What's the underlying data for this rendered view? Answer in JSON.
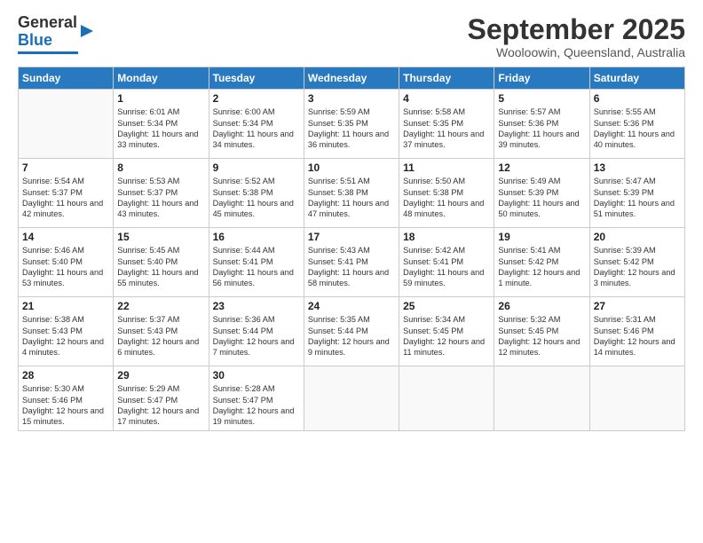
{
  "header": {
    "logo_line1": "General",
    "logo_line2": "Blue",
    "month": "September 2025",
    "location": "Wooloowin, Queensland, Australia"
  },
  "days_of_week": [
    "Sunday",
    "Monday",
    "Tuesday",
    "Wednesday",
    "Thursday",
    "Friday",
    "Saturday"
  ],
  "weeks": [
    [
      {
        "day": "",
        "sunrise": "",
        "sunset": "",
        "daylight": ""
      },
      {
        "day": "1",
        "sunrise": "Sunrise: 6:01 AM",
        "sunset": "Sunset: 5:34 PM",
        "daylight": "Daylight: 11 hours and 33 minutes."
      },
      {
        "day": "2",
        "sunrise": "Sunrise: 6:00 AM",
        "sunset": "Sunset: 5:34 PM",
        "daylight": "Daylight: 11 hours and 34 minutes."
      },
      {
        "day": "3",
        "sunrise": "Sunrise: 5:59 AM",
        "sunset": "Sunset: 5:35 PM",
        "daylight": "Daylight: 11 hours and 36 minutes."
      },
      {
        "day": "4",
        "sunrise": "Sunrise: 5:58 AM",
        "sunset": "Sunset: 5:35 PM",
        "daylight": "Daylight: 11 hours and 37 minutes."
      },
      {
        "day": "5",
        "sunrise": "Sunrise: 5:57 AM",
        "sunset": "Sunset: 5:36 PM",
        "daylight": "Daylight: 11 hours and 39 minutes."
      },
      {
        "day": "6",
        "sunrise": "Sunrise: 5:55 AM",
        "sunset": "Sunset: 5:36 PM",
        "daylight": "Daylight: 11 hours and 40 minutes."
      }
    ],
    [
      {
        "day": "7",
        "sunrise": "Sunrise: 5:54 AM",
        "sunset": "Sunset: 5:37 PM",
        "daylight": "Daylight: 11 hours and 42 minutes."
      },
      {
        "day": "8",
        "sunrise": "Sunrise: 5:53 AM",
        "sunset": "Sunset: 5:37 PM",
        "daylight": "Daylight: 11 hours and 43 minutes."
      },
      {
        "day": "9",
        "sunrise": "Sunrise: 5:52 AM",
        "sunset": "Sunset: 5:38 PM",
        "daylight": "Daylight: 11 hours and 45 minutes."
      },
      {
        "day": "10",
        "sunrise": "Sunrise: 5:51 AM",
        "sunset": "Sunset: 5:38 PM",
        "daylight": "Daylight: 11 hours and 47 minutes."
      },
      {
        "day": "11",
        "sunrise": "Sunrise: 5:50 AM",
        "sunset": "Sunset: 5:38 PM",
        "daylight": "Daylight: 11 hours and 48 minutes."
      },
      {
        "day": "12",
        "sunrise": "Sunrise: 5:49 AM",
        "sunset": "Sunset: 5:39 PM",
        "daylight": "Daylight: 11 hours and 50 minutes."
      },
      {
        "day": "13",
        "sunrise": "Sunrise: 5:47 AM",
        "sunset": "Sunset: 5:39 PM",
        "daylight": "Daylight: 11 hours and 51 minutes."
      }
    ],
    [
      {
        "day": "14",
        "sunrise": "Sunrise: 5:46 AM",
        "sunset": "Sunset: 5:40 PM",
        "daylight": "Daylight: 11 hours and 53 minutes."
      },
      {
        "day": "15",
        "sunrise": "Sunrise: 5:45 AM",
        "sunset": "Sunset: 5:40 PM",
        "daylight": "Daylight: 11 hours and 55 minutes."
      },
      {
        "day": "16",
        "sunrise": "Sunrise: 5:44 AM",
        "sunset": "Sunset: 5:41 PM",
        "daylight": "Daylight: 11 hours and 56 minutes."
      },
      {
        "day": "17",
        "sunrise": "Sunrise: 5:43 AM",
        "sunset": "Sunset: 5:41 PM",
        "daylight": "Daylight: 11 hours and 58 minutes."
      },
      {
        "day": "18",
        "sunrise": "Sunrise: 5:42 AM",
        "sunset": "Sunset: 5:41 PM",
        "daylight": "Daylight: 11 hours and 59 minutes."
      },
      {
        "day": "19",
        "sunrise": "Sunrise: 5:41 AM",
        "sunset": "Sunset: 5:42 PM",
        "daylight": "Daylight: 12 hours and 1 minute."
      },
      {
        "day": "20",
        "sunrise": "Sunrise: 5:39 AM",
        "sunset": "Sunset: 5:42 PM",
        "daylight": "Daylight: 12 hours and 3 minutes."
      }
    ],
    [
      {
        "day": "21",
        "sunrise": "Sunrise: 5:38 AM",
        "sunset": "Sunset: 5:43 PM",
        "daylight": "Daylight: 12 hours and 4 minutes."
      },
      {
        "day": "22",
        "sunrise": "Sunrise: 5:37 AM",
        "sunset": "Sunset: 5:43 PM",
        "daylight": "Daylight: 12 hours and 6 minutes."
      },
      {
        "day": "23",
        "sunrise": "Sunrise: 5:36 AM",
        "sunset": "Sunset: 5:44 PM",
        "daylight": "Daylight: 12 hours and 7 minutes."
      },
      {
        "day": "24",
        "sunrise": "Sunrise: 5:35 AM",
        "sunset": "Sunset: 5:44 PM",
        "daylight": "Daylight: 12 hours and 9 minutes."
      },
      {
        "day": "25",
        "sunrise": "Sunrise: 5:34 AM",
        "sunset": "Sunset: 5:45 PM",
        "daylight": "Daylight: 12 hours and 11 minutes."
      },
      {
        "day": "26",
        "sunrise": "Sunrise: 5:32 AM",
        "sunset": "Sunset: 5:45 PM",
        "daylight": "Daylight: 12 hours and 12 minutes."
      },
      {
        "day": "27",
        "sunrise": "Sunrise: 5:31 AM",
        "sunset": "Sunset: 5:46 PM",
        "daylight": "Daylight: 12 hours and 14 minutes."
      }
    ],
    [
      {
        "day": "28",
        "sunrise": "Sunrise: 5:30 AM",
        "sunset": "Sunset: 5:46 PM",
        "daylight": "Daylight: 12 hours and 15 minutes."
      },
      {
        "day": "29",
        "sunrise": "Sunrise: 5:29 AM",
        "sunset": "Sunset: 5:47 PM",
        "daylight": "Daylight: 12 hours and 17 minutes."
      },
      {
        "day": "30",
        "sunrise": "Sunrise: 5:28 AM",
        "sunset": "Sunset: 5:47 PM",
        "daylight": "Daylight: 12 hours and 19 minutes."
      },
      {
        "day": "",
        "sunrise": "",
        "sunset": "",
        "daylight": ""
      },
      {
        "day": "",
        "sunrise": "",
        "sunset": "",
        "daylight": ""
      },
      {
        "day": "",
        "sunrise": "",
        "sunset": "",
        "daylight": ""
      },
      {
        "day": "",
        "sunrise": "",
        "sunset": "",
        "daylight": ""
      }
    ]
  ]
}
